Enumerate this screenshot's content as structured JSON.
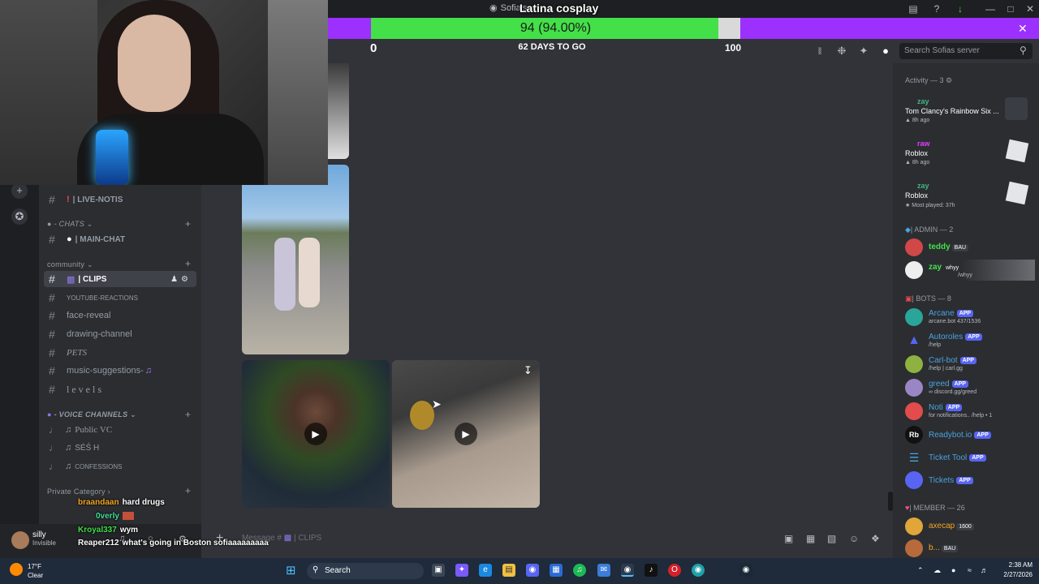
{
  "window": {
    "title": "Sofia's",
    "overlay_title": "Latina cosplay",
    "controls": [
      "—",
      "□",
      "✕"
    ]
  },
  "goal": {
    "progress_text": "94 (94.00%)",
    "progress_fraction": 0.94,
    "min": "0",
    "max": "100",
    "days_left": "62 DAYS TO GO",
    "close": "✕"
  },
  "header": {
    "search_placeholder": "Search Sofias server"
  },
  "sidebar": {
    "channels": [
      {
        "name": "| LIVE-NOTIS",
        "prefix": "#"
      },
      {
        "name": "| MAIN-CHAT",
        "prefix": "#"
      },
      {
        "name": "| CLIPS",
        "prefix": "#"
      },
      {
        "name": "YOUTUBE-REACTIONS",
        "prefix": "#"
      },
      {
        "name": "face-reveal",
        "prefix": "#"
      },
      {
        "name": "drawing-channel",
        "prefix": "#"
      },
      {
        "name": "PETS",
        "prefix": "#"
      },
      {
        "name": "music-suggestions-",
        "prefix": "#"
      },
      {
        "name": "l e v e l s",
        "prefix": "#"
      }
    ],
    "categories": {
      "chats": "- CHATS",
      "community": "community",
      "voice": "- VOICE CHANNELS",
      "private": "Private Category"
    },
    "voice_channels": [
      "Public VC",
      "SÉŚ H",
      "CONFESSIONS"
    ]
  },
  "user": {
    "name": "silly",
    "status": "Invisible"
  },
  "chat_overlay": [
    {
      "user": "braandaan",
      "user_color": "#f5a623",
      "text": "hard drugs"
    },
    {
      "user": "0verly",
      "user_color": "#43e0a0",
      "text": ""
    },
    {
      "user": "Kroyal337",
      "user_color": "#43e04a",
      "text": "wym"
    },
    {
      "user": "Reaper212",
      "user_color": "#ffffff",
      "text": "what's going in Boston sofiaaaaaaaaa"
    }
  ],
  "composer": {
    "placeholder": "Message #",
    "channel": "| CLIPS"
  },
  "members": {
    "activity_header": "Activity — 3",
    "activity": [
      {
        "user": "zay",
        "game": "Tom Clancy's Rainbow Six ...",
        "time": "8h ago"
      },
      {
        "user": "raw",
        "game": "Roblox",
        "time": "8h ago"
      },
      {
        "user": "zay",
        "game": "Roblox",
        "time": "Most played: 37h"
      }
    ],
    "admin_header": "| ADMIN — 2",
    "admins": [
      {
        "name": "teddy",
        "tag": "BAU",
        "color": "#43e04a"
      },
      {
        "name": "zay",
        "tag": "whyy",
        "sub": "/whyy",
        "color": "#43e04a"
      }
    ],
    "bots_header": "| BOTS — 8",
    "bots": [
      {
        "name": "Arcane",
        "sub": "arcane.bot 437/1536",
        "color": "#4aa3df"
      },
      {
        "name": "Autoroles",
        "sub": "/help",
        "color": "#4aa3df"
      },
      {
        "name": "Carl-bot",
        "sub": "/help | carl.gg",
        "color": "#4aa3df"
      },
      {
        "name": "greed",
        "sub": "discord.gg/greed",
        "color": "#4aa3df"
      },
      {
        "name": "Noti",
        "sub": "for notifications.. /help • 1",
        "color": "#4aa3df"
      },
      {
        "name": "Readybot.io",
        "sub": "",
        "color": "#4aa3df"
      },
      {
        "name": "Ticket Tool",
        "sub": "",
        "color": "#4aa3df"
      },
      {
        "name": "Tickets",
        "sub": "",
        "color": "#4aa3df"
      }
    ],
    "app_label": "APP",
    "member_header": "| MEMBER — 26",
    "member_list": [
      {
        "name": "axecap",
        "tag": "1600",
        "color": "#f5a623"
      },
      {
        "name": "b...",
        "tag": "BAU",
        "color": "#f5a623"
      }
    ]
  },
  "taskbar": {
    "weather_temp": "17°F",
    "weather_desc": "Clear",
    "search": "Search",
    "time": "2:38 AM",
    "date": "2/27/2026"
  }
}
